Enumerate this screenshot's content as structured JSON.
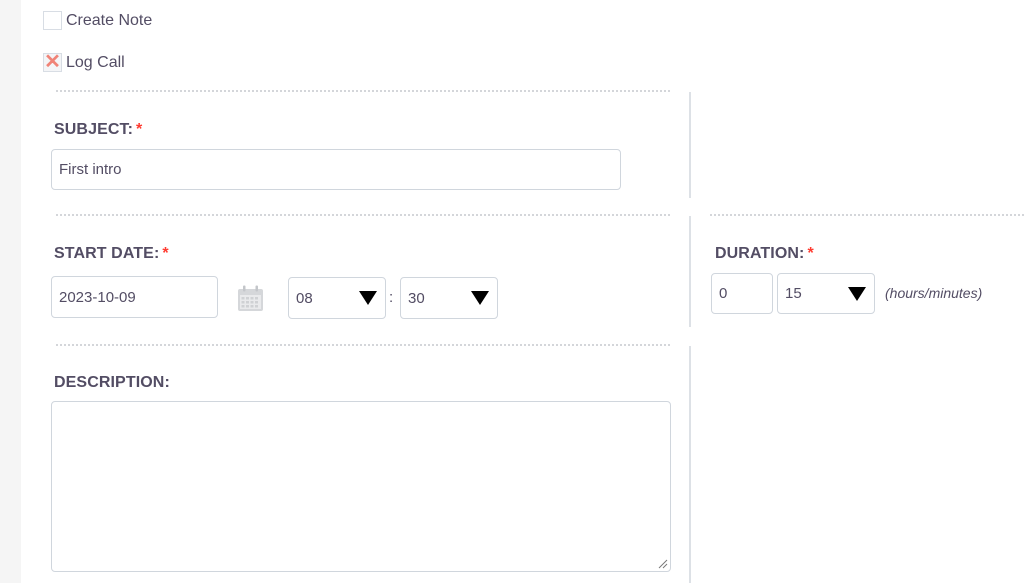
{
  "checkboxes": [
    {
      "label": "Create Note",
      "checked": false
    },
    {
      "label": "Log Call",
      "checked": true,
      "mark": "✕"
    }
  ],
  "form": {
    "subject": {
      "label": "SUBJECT:",
      "required_mark": "*",
      "value": "First intro"
    },
    "start_date": {
      "label": "START DATE:",
      "required_mark": "*",
      "date_value": "2023-10-09",
      "hour": "08",
      "separator": ":",
      "minute": "30"
    },
    "duration": {
      "label": "DURATION:",
      "required_mark": "*",
      "hours": "0",
      "minutes": "15",
      "hint": "(hours/minutes)"
    },
    "description": {
      "label": "DESCRIPTION:",
      "value": ""
    }
  },
  "icons": {
    "calendar": "calendar-icon",
    "dropdown": "triangle-down-icon",
    "checked": "x-mark-icon",
    "resize": "resize-grip-icon"
  },
  "colors": {
    "text": "#534d64",
    "required": "#ff3b30",
    "check_mark": "#f08377",
    "border": "#d0d6dd"
  }
}
